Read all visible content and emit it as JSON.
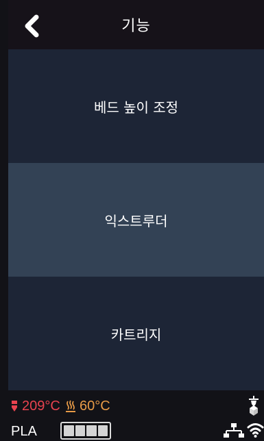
{
  "header": {
    "title": "기능",
    "back_icon": "chevron-left-icon"
  },
  "menu": {
    "items": [
      {
        "label": "베드 높이 조정",
        "state": "normal"
      },
      {
        "label": "익스트루더",
        "state": "active"
      },
      {
        "label": "카트리지",
        "state": "normal"
      }
    ]
  },
  "status": {
    "nozzle_temp": "209°C",
    "bed_temp": "60°C",
    "material": "PLA",
    "filament_level": 1,
    "icons": [
      "nozzle-icon",
      "heated-bed-icon",
      "printer-head-icon",
      "network-icon",
      "wifi-icon"
    ]
  },
  "colors": {
    "background": "#121217",
    "header": "#161219",
    "menu_dark": "#1d2536",
    "menu_active": "#334255",
    "nozzle_temp": "#e8434f",
    "bed_temp": "#e89b47"
  }
}
